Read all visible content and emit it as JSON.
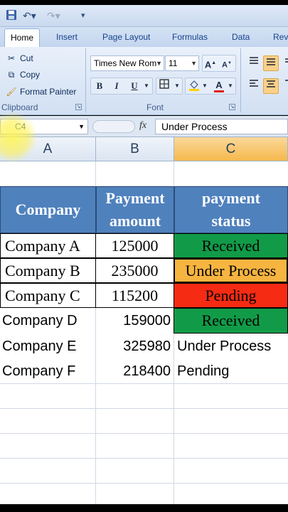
{
  "ribbon": {
    "tabs": [
      "Home",
      "Insert",
      "Page Layout",
      "Formulas",
      "Data",
      "Rev"
    ],
    "clipboard": {
      "cut": "Cut",
      "copy": "Copy",
      "format_painter": "Format Painter",
      "label": "Clipboard"
    },
    "font": {
      "family": "Times New Rom",
      "size": "11",
      "bold": "B",
      "italic": "I",
      "underline": "U",
      "label": "Font"
    }
  },
  "formula_bar": {
    "name_box": "C4",
    "fx": "fx",
    "value": "Under Process"
  },
  "columns": [
    "A",
    "B",
    "C"
  ],
  "table": {
    "headers": {
      "company": "Company",
      "amount_1": "Payment",
      "amount_2": "amount",
      "status_1": "payment",
      "status_2": "status"
    },
    "rows": [
      {
        "company": "Company A",
        "amount": "125000",
        "status": "Received"
      },
      {
        "company": "Company B",
        "amount": "235000",
        "status": "Under Process"
      },
      {
        "company": "Company C",
        "amount": "115200",
        "status": "Pending"
      },
      {
        "company": "Company D",
        "amount": "159000",
        "status": "Received"
      },
      {
        "company": "Company E",
        "amount": "325980",
        "status": "Under Process"
      },
      {
        "company": "Company F",
        "amount": "218400",
        "status": "Pending"
      }
    ]
  },
  "colors": {
    "header_blue": "#4f81bd",
    "received_green": "#119b48",
    "process_orange": "#f6b540",
    "pending_red": "#f52b13"
  }
}
